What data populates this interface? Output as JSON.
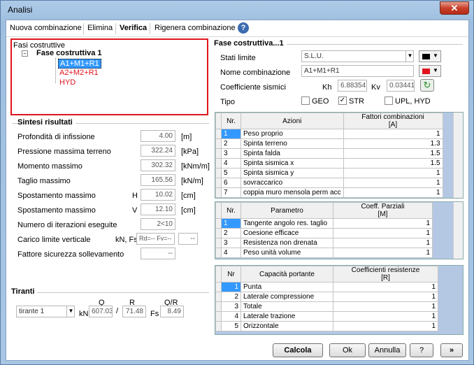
{
  "window": {
    "title": "Analisi",
    "close": "✕"
  },
  "toolbar": {
    "nuova": "Nuova combinazione",
    "elimina": "Elimina",
    "verifica": "Verifica",
    "rigenera": "Rigenera combinazione",
    "help": "?"
  },
  "tree": {
    "root": "Fasi costruttive",
    "phase": "Fase costruttiva 1",
    "items": [
      "A1+M1+R1",
      "A2+M2+R1",
      "HYD"
    ]
  },
  "sintesi": {
    "title": "Sintesi risultati",
    "rows": [
      {
        "label": "Profondità di infissione",
        "sym": "",
        "value": "4.00",
        "unit": "[m]"
      },
      {
        "label": "Pressione massima terreno",
        "sym": "",
        "value": "322.24",
        "unit": "[kPa]"
      },
      {
        "label": "Momento massimo",
        "sym": "",
        "value": "302.32",
        "unit": "[kNm/m]"
      },
      {
        "label": "Taglio massimo",
        "sym": "",
        "value": "165.56",
        "unit": "[kN/m]"
      },
      {
        "label": "Spostamento massimo",
        "sym": "H",
        "value": "10.02",
        "unit": "[cm]"
      },
      {
        "label": "Spostamento massimo",
        "sym": "V",
        "value": "12.10",
        "unit": "[cm]"
      },
      {
        "label": "Numero di iterazioni eseguite",
        "sym": "",
        "value": "2<10",
        "unit": ""
      }
    ],
    "carico_label": "Carico limite verticale",
    "carico_sym": "kN, Fs",
    "carico_value": "Rd=-- Fv=--",
    "carico_fs": "--",
    "fattore_label": "Fattore sicurezza sollevamento",
    "fattore_value": "--"
  },
  "tiranti": {
    "title": "Tiranti",
    "q": "Q",
    "r": "R",
    "qr": "Q/R",
    "select": "tirante 1",
    "kn": "kN",
    "q_val": "607.03",
    "slash": "/",
    "r_val": "71.48",
    "fs": "Fs",
    "qr_val": "8.49"
  },
  "fase": {
    "title": "Fase costruttiva...1",
    "stati_label": "Stati limite",
    "stati_value": "S.L.U.",
    "nome_label": "Nome combinazione",
    "nome_value": "A1+M1+R1",
    "coeff_label": "Coefficiente sismici",
    "kh": "Kh",
    "kh_val": "6.88354",
    "kv": "Kv",
    "kv_val": "0.03441",
    "tipo_label": "Tipo",
    "geo": "GEO",
    "str": "STR",
    "upl": "UPL, HYD",
    "color1": "#000000",
    "color2": "#e0141c"
  },
  "azioni": {
    "headers": [
      "Nr.",
      "Azioni",
      "Fattori combinazioni\n[A]"
    ],
    "rows": [
      [
        "1",
        "Peso proprio",
        "1"
      ],
      [
        "2",
        "Spinta terreno",
        "1.3"
      ],
      [
        "3",
        "Spinta falda",
        "1.5"
      ],
      [
        "4",
        "Spinta sismica x",
        "1.5"
      ],
      [
        "5",
        "Spinta sismica y",
        "1"
      ],
      [
        "6",
        "sovraccarico",
        "1"
      ],
      [
        "7",
        "coppia muro mensola perm acc",
        "1"
      ]
    ]
  },
  "param": {
    "headers": [
      "Nr.",
      "Parametro",
      "Coeff. Parziali\n[M]"
    ],
    "rows": [
      [
        "1",
        "Tangente angolo res. taglio",
        "1"
      ],
      [
        "2",
        "Coesione efficace",
        "1"
      ],
      [
        "3",
        "Resistenza non drenata",
        "1"
      ],
      [
        "4",
        "Peso unità volume",
        "1"
      ]
    ]
  },
  "capac": {
    "headers": [
      "Nr",
      "Capacità portante",
      "Coefficienti resistenze\n[R]"
    ],
    "rows": [
      [
        "1",
        "Punta",
        "1"
      ],
      [
        "2",
        "Laterale compressione",
        "1"
      ],
      [
        "3",
        "Totale",
        "1"
      ],
      [
        "4",
        "Laterale trazione",
        "1"
      ],
      [
        "5",
        "Orizzontale",
        "1"
      ]
    ]
  },
  "buttons": {
    "calcola": "Calcola",
    "ok": "Ok",
    "annulla": "Annulla",
    "help": "?",
    "more": "»"
  }
}
